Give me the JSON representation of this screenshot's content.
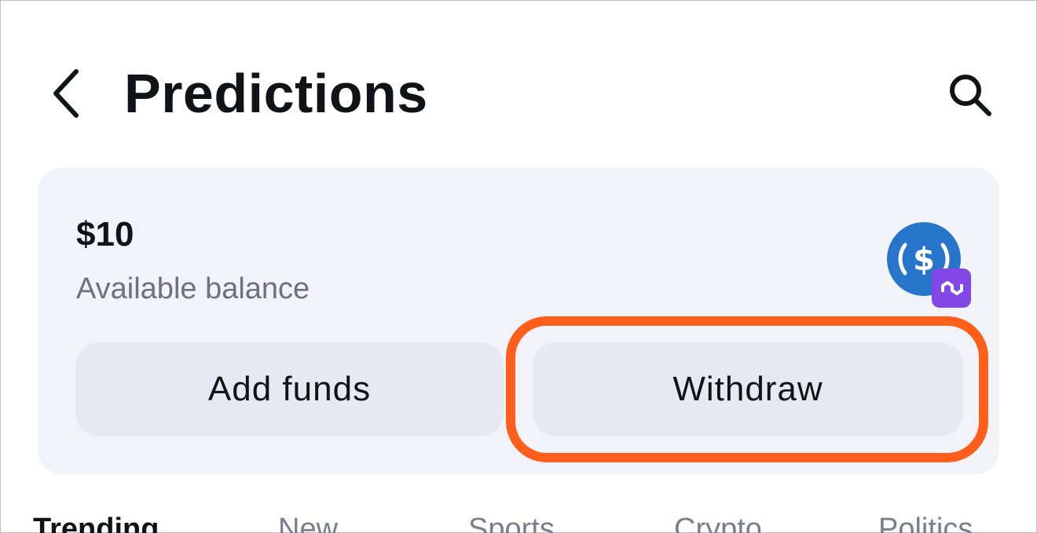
{
  "header": {
    "title": "Predictions",
    "back_icon": "chevron-left-icon",
    "search_icon": "search-icon"
  },
  "balance_card": {
    "amount": "$10",
    "label": "Available balance",
    "token_icon": "usdc-icon",
    "network_badge_icon": "polygon-icon",
    "add_funds_label": "Add funds",
    "withdraw_label": "Withdraw"
  },
  "tabs": [
    {
      "label": "Trending",
      "active": true
    },
    {
      "label": "New",
      "active": false
    },
    {
      "label": "Sports",
      "active": false
    },
    {
      "label": "Crypto",
      "active": false
    },
    {
      "label": "Politics",
      "active": false
    }
  ],
  "colors": {
    "highlight": "#ff5f1a",
    "usdc_blue": "#2775ca",
    "polygon_purple": "#8247e5",
    "card_bg": "#f2f3f9",
    "button_bg": "#e7e8f2"
  }
}
